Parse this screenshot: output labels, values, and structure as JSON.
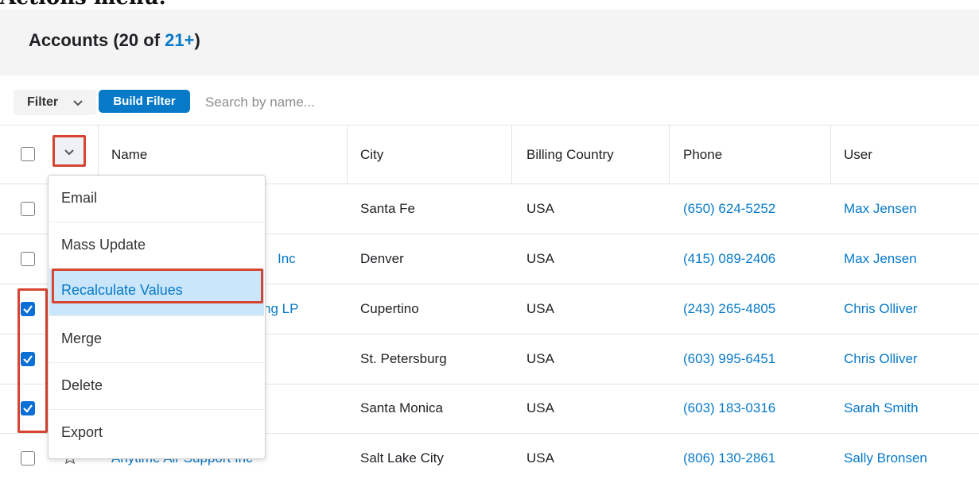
{
  "doc_cut_text": "Actions menu.",
  "header": {
    "title": "Accounts (20 of ",
    "count_link": "21+",
    "title_end": ")"
  },
  "filter": {
    "label": "Filter",
    "build_filter": "Build Filter",
    "search_placeholder": "Search by name..."
  },
  "columns": [
    "Name",
    "City",
    "Billing Country",
    "Phone",
    "User"
  ],
  "rows": [
    {
      "name": "",
      "city": "Santa Fe",
      "country": "USA",
      "phone": "(650) 624-5252",
      "user": "Max Jensen",
      "checked": false
    },
    {
      "name": "Inc",
      "city": "Denver",
      "country": "USA",
      "phone": "(415) 089-2406",
      "user": "Max Jensen",
      "checked": false
    },
    {
      "name": "ng LP",
      "city": "Cupertino",
      "country": "USA",
      "phone": "(243) 265-4805",
      "user": "Chris Olliver",
      "checked": true
    },
    {
      "name": "",
      "city": "St. Petersburg",
      "country": "USA",
      "phone": "(603) 995-6451",
      "user": "Chris Olliver",
      "checked": true
    },
    {
      "name": "",
      "city": "Santa Monica",
      "country": "USA",
      "phone": "(603) 183-0316",
      "user": "Sarah Smith",
      "checked": true
    },
    {
      "name": "Anytime Air Support Inc",
      "city": "Salt Lake City",
      "country": "USA",
      "phone": "(806) 130-2861",
      "user": "Sally Bronsen",
      "checked": false
    }
  ],
  "actions_menu": [
    "Email",
    "Mass Update",
    "Recalculate Values",
    "Merge",
    "Delete",
    "Export"
  ],
  "colors": {
    "accent": "#0679c8",
    "highlight": "#d64532",
    "menu_active_bg": "#c9e6fb"
  }
}
